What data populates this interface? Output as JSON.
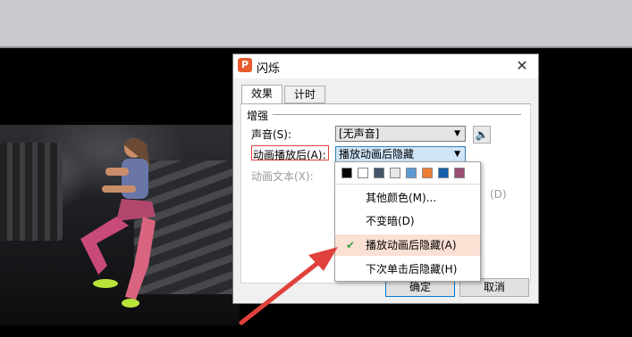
{
  "dialog": {
    "title": "闪烁",
    "app_icon_letter": "P",
    "close_symbol": "✕",
    "tabs": [
      "效果",
      "计时"
    ],
    "group_label": "增强",
    "sound_label": "声音(S):",
    "sound_value": "[无声音]",
    "after_animation_label": "动画播放后(A):",
    "after_animation_value": "播放动画后隐藏",
    "animate_text_label": "动画文本(X):",
    "partial_hidden_text": "(D)",
    "ok_label": "确定",
    "cancel_label": "取消"
  },
  "dropdown": {
    "swatches": [
      "#000000",
      "#ffffff",
      "#44546a",
      "#e7e6e6",
      "#5b9bd5",
      "#ed7d31",
      "#1460aa",
      "#9c4e74"
    ],
    "items": [
      {
        "label": "其他颜色(M)..."
      },
      {
        "label": "不变暗(D)"
      },
      {
        "label": "播放动画后隐藏(A)",
        "selected": true
      },
      {
        "label": "下次单击后隐藏(H)"
      }
    ],
    "check_symbol": "✔"
  },
  "colors": {
    "accent_red": "#e0413c",
    "selected_bg": "#fbe0d4",
    "check_green": "#3aa142"
  }
}
